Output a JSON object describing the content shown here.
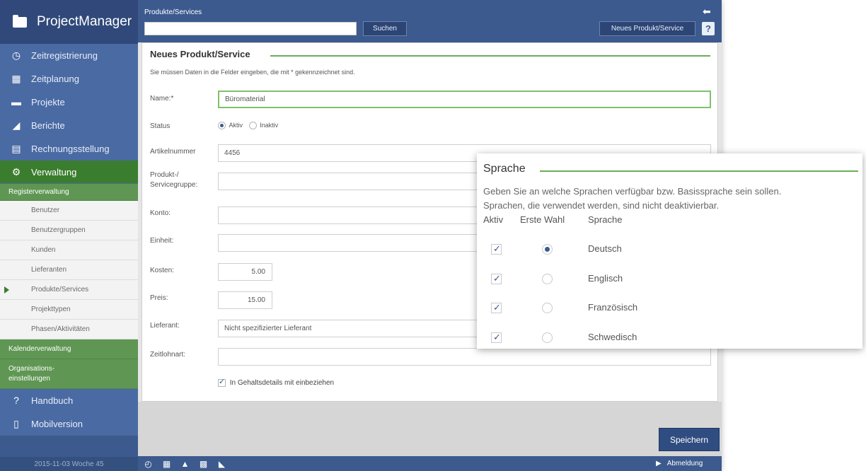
{
  "app": {
    "title": "ProjectManager"
  },
  "sidebar": {
    "items": [
      {
        "label": "Zeitregistrierung",
        "icon": "clock-icon"
      },
      {
        "label": "Zeitplanung",
        "icon": "calendar-icon"
      },
      {
        "label": "Projekte",
        "icon": "folder-icon"
      },
      {
        "label": "Berichte",
        "icon": "chart-icon"
      },
      {
        "label": "Rechnungsstellung",
        "icon": "invoice-icon"
      },
      {
        "label": "Verwaltung",
        "icon": "gears-icon",
        "active": true
      }
    ],
    "section_registry": "Registerverwaltung",
    "sub_items": [
      "Benutzer",
      "Benutzergruppen",
      "Kunden",
      "Lieferanten",
      "Produkte/Services",
      "Projekttypen",
      "Phasen/Aktivitäten"
    ],
    "current_sub": "Produkte/Services",
    "section_calendar": "Kalenderverwaltung",
    "section_org_line1": "Organisations-",
    "section_org_line2": "einstellungen",
    "bottom_items": [
      {
        "label": "Handbuch",
        "icon": "help-icon"
      },
      {
        "label": "Mobilversion",
        "icon": "mobile-icon"
      }
    ],
    "date": "2015-11-03 Woche 45"
  },
  "topbar": {
    "breadcrumb": "Produkte/Services",
    "search_button": "Suchen",
    "new_button": "Neues Produkt/Service"
  },
  "form": {
    "title": "Neues Produkt/Service",
    "hint": "Sie müssen Daten in die Felder eingeben, die mit * gekennzeichnet sind.",
    "name_label": "Name:*",
    "name_value": "Büromaterial",
    "status_label": "Status",
    "status_active": "Aktiv",
    "status_inactive": "Inaktiv",
    "article_label": "Artikelnummer",
    "article_value": "4456",
    "group_label_1": "Produkt-/",
    "group_label_2": "Servicegruppe:",
    "account_label": "Konto:",
    "unit_label": "Einheit:",
    "cost_label": "Kosten:",
    "cost_value": "5.00",
    "price_label": "Preis:",
    "price_value": "15.00",
    "supplier_label": "Lieferant:",
    "supplier_value": "Nicht spezifizierter Lieferant",
    "wagetype_label": "Zeitlohnart:",
    "include_label": "In Gehaltsdetails mit einbeziehen",
    "save_button": "Speichern"
  },
  "footer": {
    "logout": "Abmeldung"
  },
  "popup": {
    "title": "Sprache",
    "text_line1": "Geben Sie an welche Sprachen verfügbar bzw. Basissprache sein sollen.",
    "text_line2": "Sprachen, die verwendet werden, sind nicht deaktivierbar.",
    "col_active": "Aktiv",
    "col_first": "Erste Wahl",
    "col_language": "Sprache",
    "languages": [
      {
        "name": "Deutsch",
        "active": true,
        "first": true
      },
      {
        "name": "Englisch",
        "active": true,
        "first": false
      },
      {
        "name": "Französisch",
        "active": true,
        "first": false
      },
      {
        "name": "Schwedisch",
        "active": true,
        "first": false
      }
    ]
  },
  "colors": {
    "brand": "#3c5a8e",
    "accent_green": "#3b7d2e",
    "rule_green": "#6aae57"
  }
}
